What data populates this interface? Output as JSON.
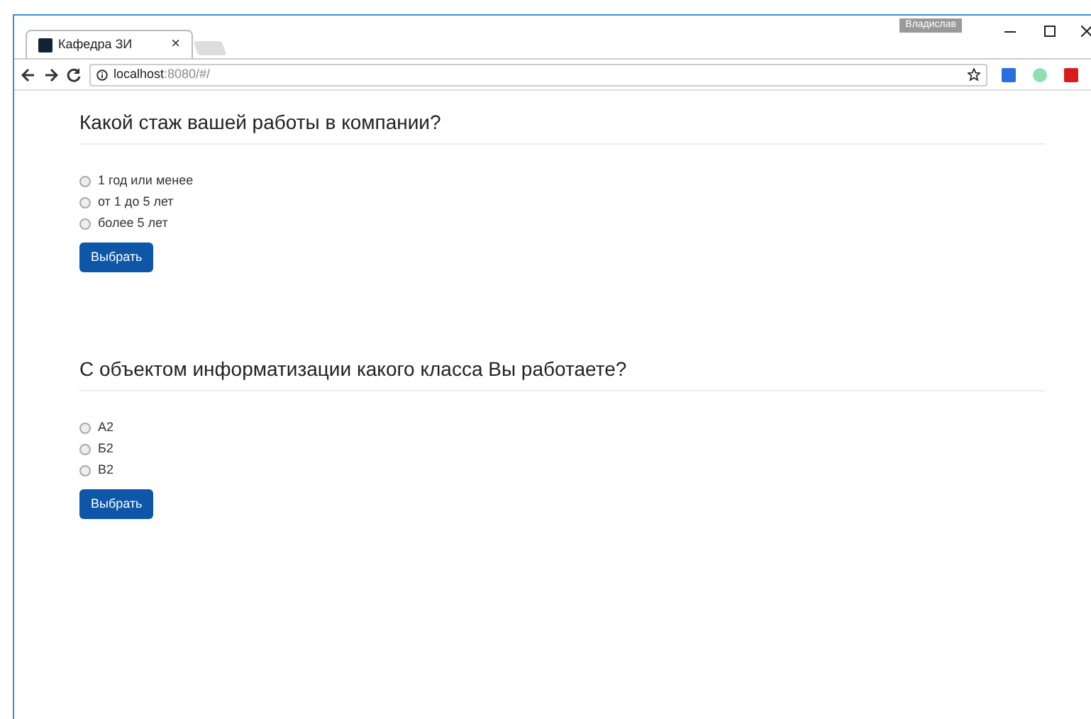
{
  "browser": {
    "profile": "Владислав",
    "tab": {
      "title": "Кафедра ЗИ",
      "close": "×"
    },
    "address": {
      "host": "localhost",
      "rest": ":8080/#/"
    }
  },
  "questions": [
    {
      "title": "Какой стаж вашей работы в компании?",
      "options": [
        {
          "label": "1 год или менее",
          "selected": false
        },
        {
          "label": "от 1 до 5 лет",
          "selected": false
        },
        {
          "label": "более 5 лет",
          "selected": false
        }
      ],
      "button": "Выбрать"
    },
    {
      "title": "С объектом информатизации какого класса Вы работаете?",
      "options": [
        {
          "label": "А2",
          "selected": false
        },
        {
          "label": "Б2",
          "selected": false
        },
        {
          "label": "В2",
          "selected": false
        }
      ],
      "button": "Выбрать"
    }
  ]
}
